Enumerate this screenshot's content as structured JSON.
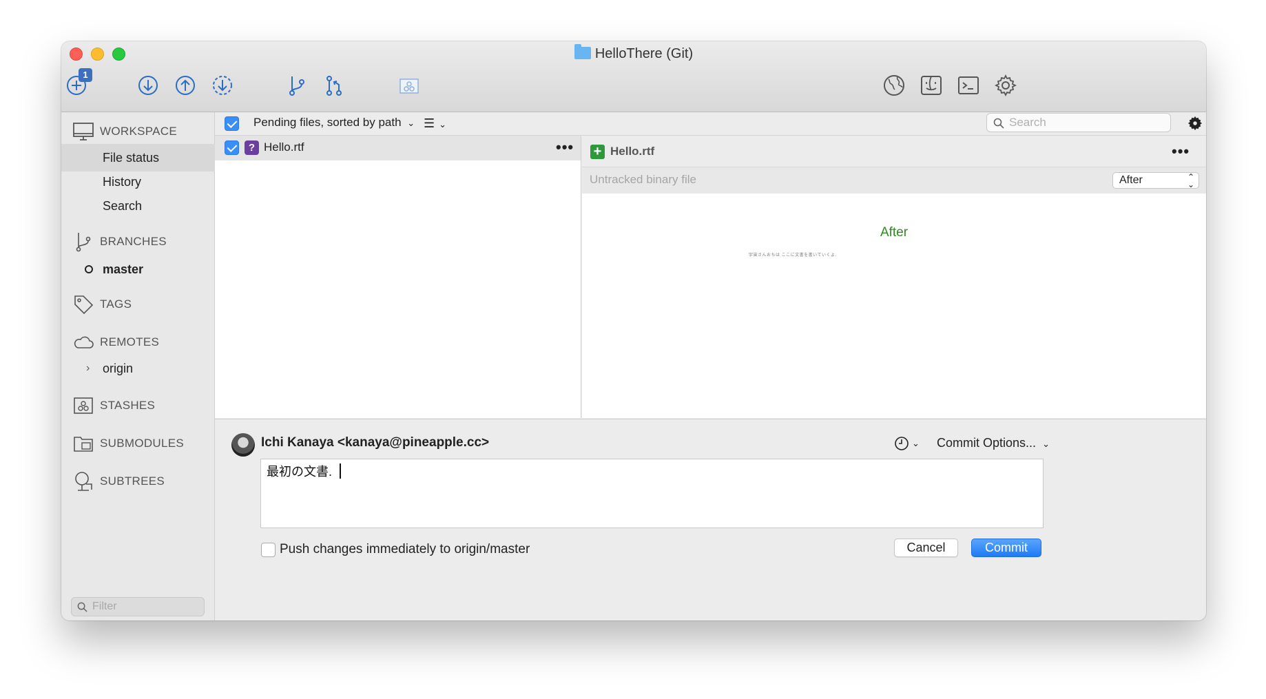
{
  "window": {
    "title": "HelloThere (Git)"
  },
  "toolbar": {
    "new_badge": "1",
    "icons": [
      "new-icon",
      "pull-icon",
      "push-icon",
      "fetch-icon",
      "branch-icon",
      "merge-icon",
      "stash-icon",
      "browser-icon",
      "finder-icon",
      "terminal-icon",
      "settings-icon"
    ]
  },
  "sidebar": {
    "workspace": "WORKSPACE",
    "file_status": "File status",
    "history": "History",
    "search": "Search",
    "branches": "BRANCHES",
    "branch_current": "master",
    "tags": "TAGS",
    "remotes": "REMOTES",
    "remote_origin": "origin",
    "stashes": "STASHES",
    "submodules": "SUBMODULES",
    "subtrees": "SUBTREES",
    "filter_placeholder": "Filter"
  },
  "filebar": {
    "sort_label": "Pending files, sorted by path",
    "search_placeholder": "Search",
    "select_all_checked": true
  },
  "files": [
    {
      "name": "Hello.rtf",
      "status": "untracked",
      "checked": true
    }
  ],
  "diff": {
    "file_name": "Hello.rtf",
    "status_text": "Untracked binary file",
    "view_select": "After",
    "preview_label": "After",
    "preview_text": "宇宙さんおちは ここに文書を書いていくよ."
  },
  "commit": {
    "author": "Ichi Kanaya <kanaya@pineapple.cc>",
    "options_label": "Commit Options...",
    "message": "最初の文書.",
    "push_label": "Push changes immediately to origin/master",
    "push_checked": false,
    "cancel_label": "Cancel",
    "commit_label": "Commit"
  },
  "colors": {
    "accent": "#1f7bf5",
    "added": "#2c9a3a",
    "untracked": "#6b3fa0",
    "after_label": "#2c8a1e"
  }
}
